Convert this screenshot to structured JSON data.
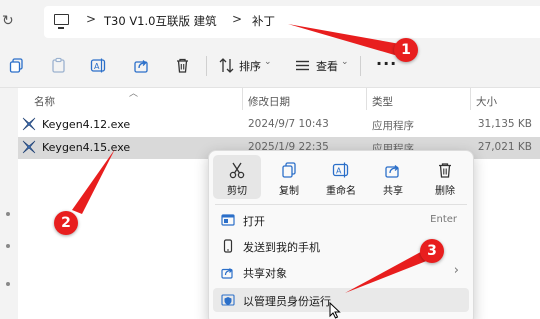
{
  "address": {
    "crumbs": [
      "T30 V1.0互联版 建筑",
      "补丁"
    ],
    "separator": ">"
  },
  "toolbar": {
    "sort_label": "排序",
    "view_label": "查看",
    "more_label": "···",
    "caret": "⌄"
  },
  "columns": {
    "name": "名称",
    "date": "修改日期",
    "type": "类型",
    "size": "大小"
  },
  "files": [
    {
      "name": "Keygen4.12.exe",
      "date": "2024/9/7 10:43",
      "type": "应用程序",
      "size": "31,135 KB",
      "selected": false
    },
    {
      "name": "Keygen4.15.exe",
      "date": "2025/1/9 22:35",
      "type": "应用程序",
      "size": "27,021 KB",
      "selected": true
    }
  ],
  "context_menu": {
    "quick_actions": [
      {
        "label": "剪切",
        "icon": "cut-icon"
      },
      {
        "label": "复制",
        "icon": "copy-icon"
      },
      {
        "label": "重命名",
        "icon": "rename-icon"
      },
      {
        "label": "共享",
        "icon": "share-icon"
      },
      {
        "label": "删除",
        "icon": "delete-icon"
      }
    ],
    "items": [
      {
        "label": "打开",
        "shortcut": "Enter",
        "icon": "open-icon"
      },
      {
        "label": "发送到我的手机",
        "icon": "phone-icon"
      },
      {
        "label": "共享对象",
        "icon": "share-icon",
        "submenu_arrow": "›"
      },
      {
        "label": "以管理员身份运行",
        "icon": "admin-shield-icon"
      }
    ]
  },
  "annotations": {
    "badges": [
      "1",
      "2",
      "3"
    ],
    "color": "#e81e1e"
  },
  "colors": {
    "selected_row": "#d9d9d9",
    "background": "#f3f3f3"
  }
}
